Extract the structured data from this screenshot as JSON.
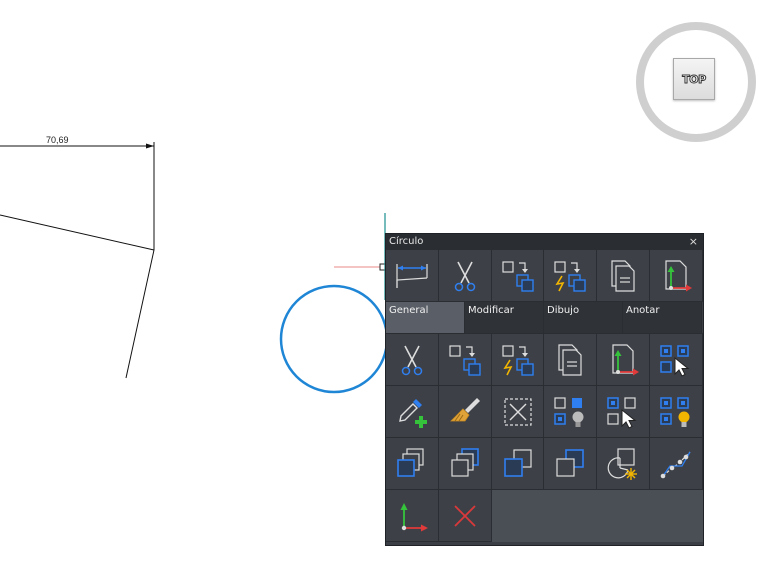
{
  "drawing": {
    "dimension_value": "70,69"
  },
  "viewcube": {
    "face_label": "TOP"
  },
  "quad": {
    "title": "Círculo",
    "close_symbol": "×",
    "tabs": [
      {
        "label": "General",
        "active": true
      },
      {
        "label": "Modificar",
        "active": false
      },
      {
        "label": "Dibujo",
        "active": false
      },
      {
        "label": "Anotar",
        "active": false
      }
    ],
    "top_row_icons": [
      "dimension-icon",
      "cut-icon",
      "copy-base-icon",
      "paste-lightning-icon",
      "paste-document-icon",
      "ucs-document-icon"
    ],
    "grid_icons": [
      [
        "cut-icon",
        "copy-base-icon",
        "paste-lightning-icon",
        "paste-document-icon",
        "ucs-document-icon",
        "select-cursor-icon"
      ],
      [
        "eyedropper-add-icon",
        "match-properties-brush-icon",
        "delete-selection-icon",
        "layer-bulb-icon",
        "select-similar-cursor-icon",
        "layer-bulb-on-icon"
      ],
      [
        "bring-to-front-icon",
        "send-to-back-icon",
        "bring-above-icon",
        "send-under-icon",
        "pie-snap-icon",
        "polyline-vertex-icon"
      ],
      [
        "ucs-axis-icon",
        "cancel-x-icon"
      ]
    ]
  },
  "colors": {
    "panel_bg": "#3d4147",
    "accent_blue": "#2f7ff0",
    "circle_blue": "#1f86d6",
    "green": "#35c33c",
    "red": "#e03a3a",
    "yellow": "#f3b600"
  }
}
